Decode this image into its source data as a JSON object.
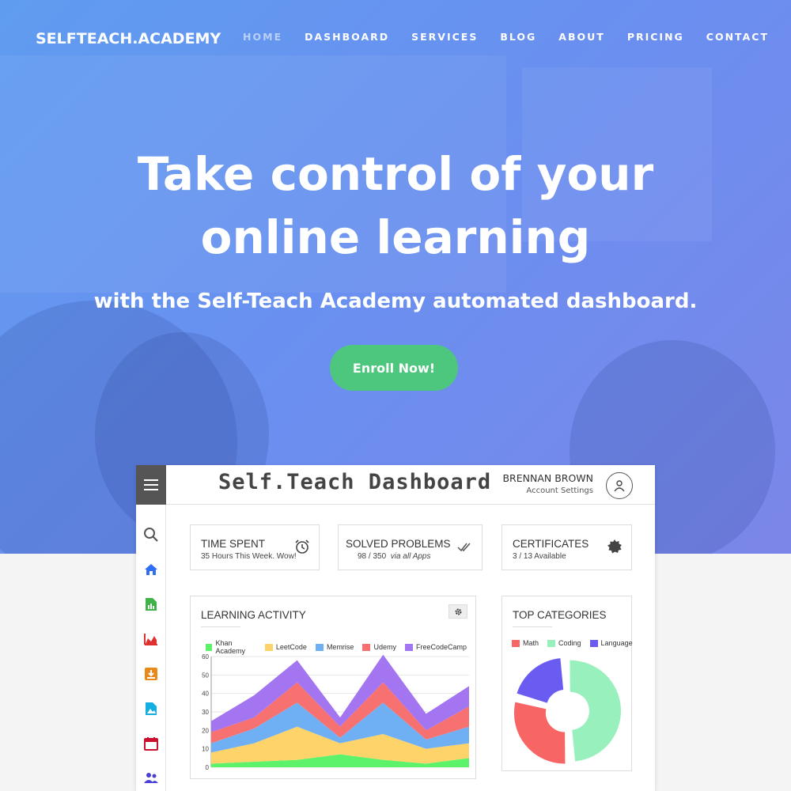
{
  "brand": "SELFTEACH.ACADEMY",
  "nav": [
    {
      "label": "HOME",
      "active": true
    },
    {
      "label": "DASHBOARD"
    },
    {
      "label": "SERVICES"
    },
    {
      "label": "BLOG"
    },
    {
      "label": "ABOUT"
    },
    {
      "label": "PRICING"
    },
    {
      "label": "CONTACT"
    }
  ],
  "hero": {
    "headline": "Take control of your online learning",
    "subhead": "with the Self-Teach Academy automated dashboard.",
    "cta": "Enroll Now!"
  },
  "colors": {
    "hero_start": "#5f9cf0",
    "hero_end": "#7b86e8",
    "cta": "#4ec77e"
  },
  "dashboard": {
    "title": "Self.Teach Dashboard",
    "user_name": "BRENNAN BROWN",
    "user_sub": "Account Settings",
    "sidebar_icons": [
      "search-icon",
      "home-icon",
      "report-icon",
      "area-chart-icon",
      "download-box-icon",
      "image-file-icon",
      "calendar-icon",
      "people-icon"
    ],
    "stats": [
      {
        "title": "TIME SPENT",
        "sub": "35 Hours This Week. Wow!",
        "icon": "alarm-clock-icon"
      },
      {
        "title": "SOLVED PROBLEMS",
        "sub_value": "98 / 350",
        "sub_note": "via all Apps",
        "icon": "double-check-icon"
      },
      {
        "title": "CERTIFICATES",
        "sub": "3 / 13  Available",
        "icon": "badge-icon"
      }
    ],
    "activity": {
      "title": "LEARNING ACTIVITY",
      "legend": [
        {
          "name": "Khan Academy",
          "color": "#5cf26a"
        },
        {
          "name": "LeetCode",
          "color": "#fdd36a"
        },
        {
          "name": "Memrise",
          "color": "#6fb0f5"
        },
        {
          "name": "Udemy",
          "color": "#f87171"
        },
        {
          "name": "FreeCodeCamp",
          "color": "#a475f0"
        }
      ]
    },
    "categories": {
      "title": "TOP CATEGORIES",
      "legend": [
        {
          "name": "Math",
          "color": "#f76565"
        },
        {
          "name": "Coding",
          "color": "#98f0bd"
        },
        {
          "name": "Language",
          "color": "#6a5cf0"
        }
      ]
    }
  },
  "chart_data": [
    {
      "type": "area",
      "title": "LEARNING ACTIVITY",
      "stacked": true,
      "x": [
        1,
        2,
        3,
        4,
        5,
        6,
        7
      ],
      "ylim": [
        0,
        60
      ],
      "yticks": [
        0,
        10,
        20,
        30,
        40,
        50,
        60
      ],
      "series": [
        {
          "name": "Khan Academy",
          "values": [
            2,
            3,
            4,
            7,
            4,
            2,
            5
          ]
        },
        {
          "name": "LeetCode",
          "values": [
            6,
            10,
            18,
            6,
            14,
            8,
            8
          ]
        },
        {
          "name": "Memrise",
          "values": [
            5,
            8,
            13,
            3,
            17,
            5,
            9
          ]
        },
        {
          "name": "Udemy",
          "values": [
            6,
            6,
            11,
            6,
            11,
            5,
            11
          ]
        },
        {
          "name": "FreeCodeCamp",
          "values": [
            6,
            12,
            12,
            5,
            15,
            9,
            11
          ]
        }
      ],
      "grid": true
    },
    {
      "type": "pie",
      "title": "TOP CATEGORIES",
      "donut": true,
      "labels": [
        "Math",
        "Coding",
        "Language"
      ],
      "values": [
        30,
        50,
        20
      ]
    }
  ]
}
